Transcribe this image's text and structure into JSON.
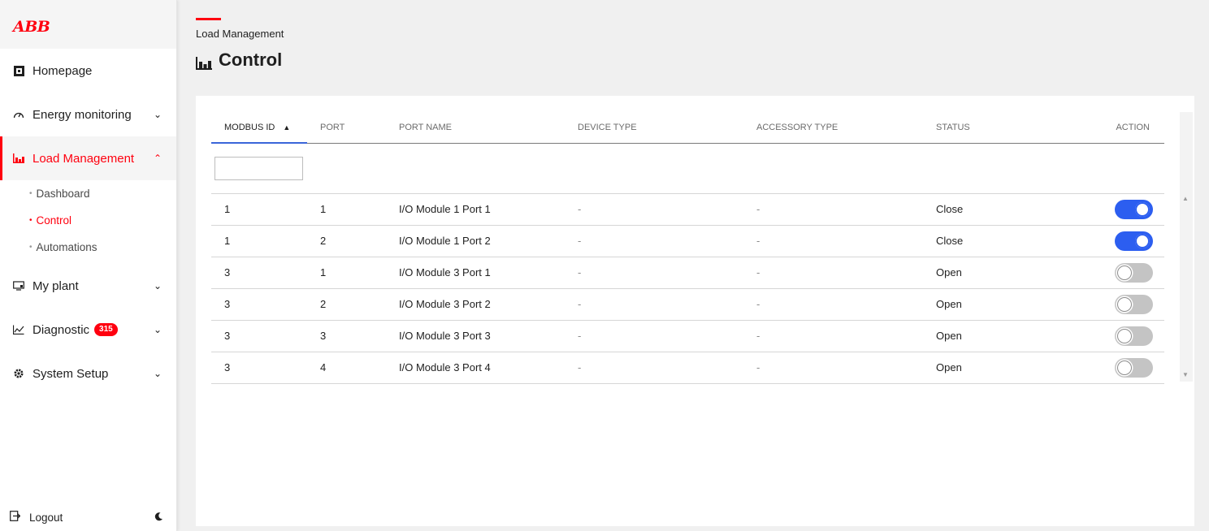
{
  "brand": {
    "logo_text": "ABB",
    "accent": "#ff000f",
    "toggle_on": "#2c5ef0"
  },
  "sidebar": {
    "items": [
      {
        "label": "Homepage",
        "icon": "home-square-icon"
      },
      {
        "label": "Energy monitoring",
        "icon": "gauge-icon"
      },
      {
        "label": "Load Management",
        "icon": "bar-chart-icon"
      },
      {
        "label": "My plant",
        "icon": "monitor-icon"
      },
      {
        "label": "Diagnostic",
        "icon": "line-chart-icon",
        "badge": "315"
      },
      {
        "label": "System Setup",
        "icon": "gear-icon"
      }
    ],
    "sub_items": [
      {
        "label": "Dashboard"
      },
      {
        "label": "Control"
      },
      {
        "label": "Automations"
      }
    ],
    "logout_label": "Logout"
  },
  "header": {
    "breadcrumb": "Load Management",
    "title": "Control"
  },
  "table": {
    "columns": [
      "MODBUS ID",
      "PORT",
      "PORT NAME",
      "DEVICE TYPE",
      "ACCESSORY TYPE",
      "STATUS",
      "ACTION"
    ],
    "filter_value": "",
    "rows": [
      {
        "modbus_id": "1",
        "port": "1",
        "port_name": "I/O Module 1 Port 1",
        "device_type": "-",
        "accessory_type": "-",
        "status": "Close",
        "action_on": true
      },
      {
        "modbus_id": "1",
        "port": "2",
        "port_name": "I/O Module 1 Port 2",
        "device_type": "-",
        "accessory_type": "-",
        "status": "Close",
        "action_on": true
      },
      {
        "modbus_id": "3",
        "port": "1",
        "port_name": "I/O Module 3 Port 1",
        "device_type": "-",
        "accessory_type": "-",
        "status": "Open",
        "action_on": false
      },
      {
        "modbus_id": "3",
        "port": "2",
        "port_name": "I/O Module 3 Port 2",
        "device_type": "-",
        "accessory_type": "-",
        "status": "Open",
        "action_on": false
      },
      {
        "modbus_id": "3",
        "port": "3",
        "port_name": "I/O Module 3 Port 3",
        "device_type": "-",
        "accessory_type": "-",
        "status": "Open",
        "action_on": false
      },
      {
        "modbus_id": "3",
        "port": "4",
        "port_name": "I/O Module 3 Port 4",
        "device_type": "-",
        "accessory_type": "-",
        "status": "Open",
        "action_on": false
      }
    ]
  }
}
